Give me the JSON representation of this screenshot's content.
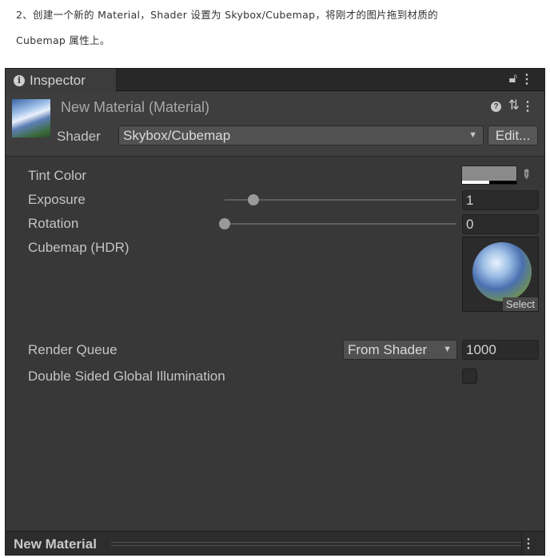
{
  "article": {
    "line1": "2、创建一个新的 Material，Shader 设置为 Skybox/Cubemap，将刚才的图片拖到材质的",
    "line2": "Cubemap 属性上。"
  },
  "inspector": {
    "tab_label": "Inspector",
    "lock_icon": "lock-icon",
    "menu_icon": "kebab-menu-icon"
  },
  "header": {
    "title": "New Material (Material)",
    "shader_label": "Shader",
    "shader_value": "Skybox/Cubemap",
    "edit_label": "Edit..."
  },
  "properties": {
    "tint_label": "Tint Color",
    "tint_color": "#8a8a8a",
    "exposure_label": "Exposure",
    "exposure_value": "1",
    "exposure_fraction": 0.125,
    "rotation_label": "Rotation",
    "rotation_value": "0",
    "rotation_fraction": 0.0,
    "cubemap_label": "Cubemap   (HDR)",
    "cubemap_select": "Select",
    "render_queue_label": "Render Queue",
    "render_queue_option": "From Shader",
    "render_queue_value": "1000",
    "dsgi_label": "Double Sided Global Illumination"
  },
  "footer": {
    "title": "New Material"
  }
}
